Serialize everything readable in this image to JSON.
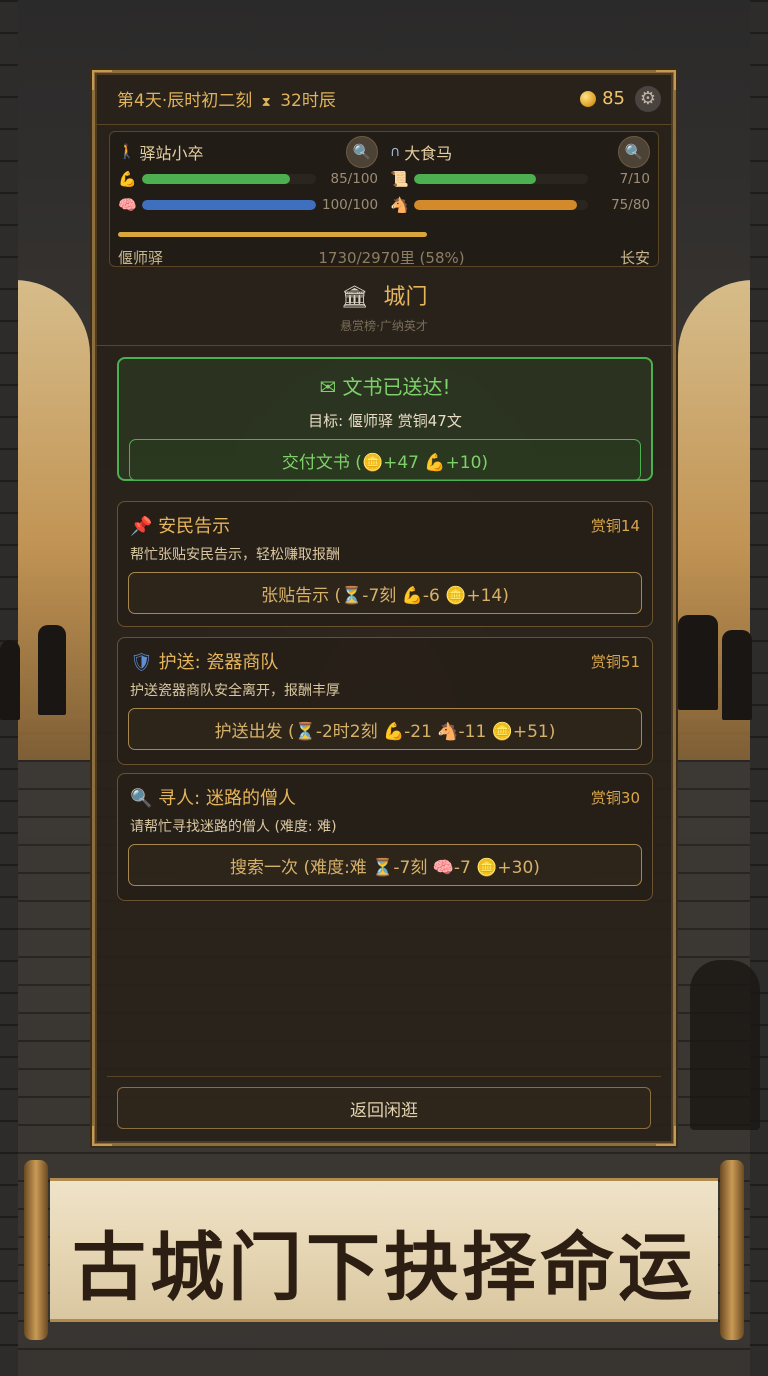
{
  "topbar": {
    "time_text": "第4天·辰时初二刻",
    "hourglass_icon": "hourglass-icon",
    "remaining": "32时辰",
    "coins": "85",
    "settings_icon": "gear-icon"
  },
  "status": {
    "player": {
      "name": "驿站小卒",
      "stats": [
        {
          "icon": "muscle-icon",
          "value": "85/100",
          "fill": 0.85,
          "color": "#4caf50"
        },
        {
          "icon": "brain-icon",
          "value": "100/100",
          "fill": 1.0,
          "color": "#3f6fbf"
        }
      ]
    },
    "horse": {
      "name": "大食马",
      "stats": [
        {
          "icon": "scroll-icon",
          "value": "7/10",
          "fill": 0.7,
          "color": "#4caf50"
        },
        {
          "icon": "horse-icon",
          "value": "75/80",
          "fill": 0.9375,
          "color": "#d28a2a"
        }
      ]
    },
    "route": {
      "from": "偃师驿",
      "progress_text": "1730/2970里 (58%)",
      "progress": 0.58,
      "to": "长安"
    }
  },
  "city": {
    "name": "城门",
    "subtitle": "悬赏榜·广纳英才"
  },
  "delivered": {
    "title": "文书已送达!",
    "target": "目标: 偃师驿  赏铜47文",
    "button": "交付文书 (🪙+47 💪+10)"
  },
  "quests": [
    {
      "icon": "📌",
      "icon_name": "pin-icon",
      "title": "安民告示",
      "reward": "赏铜14",
      "desc": "帮忙张贴安民告示，轻松赚取报酬",
      "button": "张贴告示 (⏳-7刻 💪-6 🪙+14)"
    },
    {
      "icon": "🛡",
      "icon_name": "shield-icon",
      "title": "护送: 瓷器商队",
      "reward": "赏铜51",
      "desc": "护送瓷器商队安全离开，报酬丰厚",
      "button": "护送出发 (⏳-2时2刻 💪-21 🐴-11 🪙+51)"
    },
    {
      "icon": "🔍",
      "icon_name": "search-icon",
      "title": "寻人: 迷路的僧人",
      "reward": "赏铜30",
      "desc": "请帮忙寻找迷路的僧人 (难度: 难)",
      "button": "搜索一次 (难度:难 ⏳-7刻 🧠-7 🪙+30)"
    }
  ],
  "back_button": "返回闲逛",
  "banner": {
    "slogan": "古城门下抉择命运"
  }
}
